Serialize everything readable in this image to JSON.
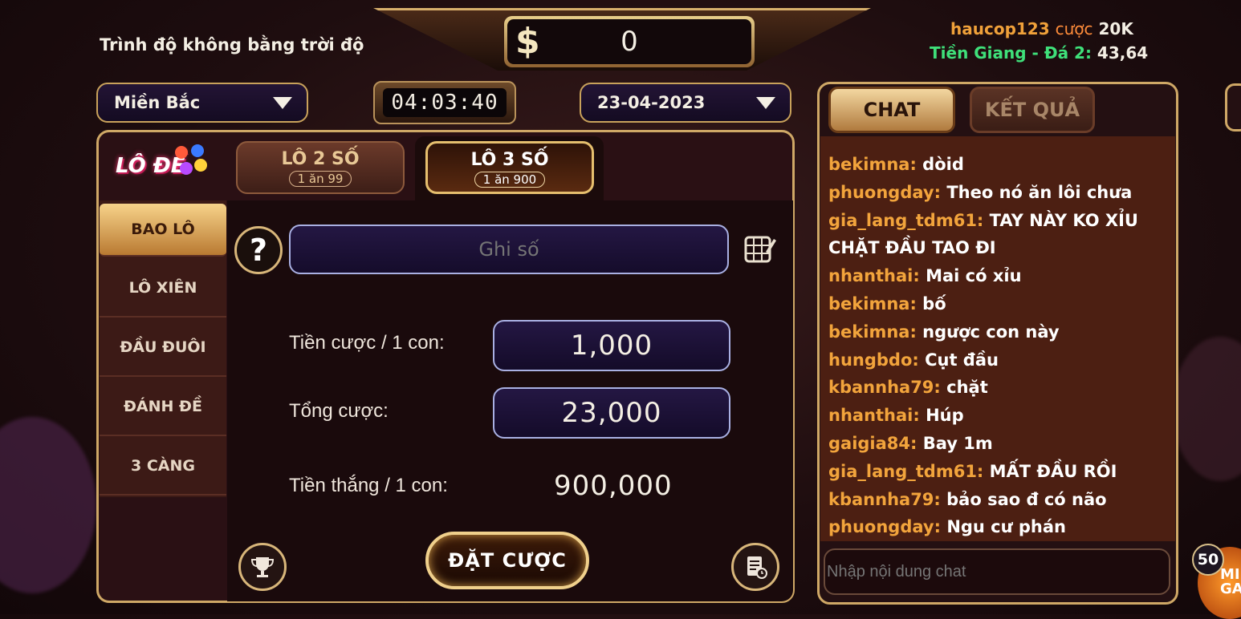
{
  "header": {
    "slogan": "Trình độ không bằng trời độ",
    "balance_icon": "$",
    "balance": "0",
    "ticker": {
      "user": "haucop123",
      "bet_word": "cược",
      "bet_amount": "20K",
      "region_text": "Tiền Giang - Đá 2:",
      "odds": "43,64"
    }
  },
  "controls": {
    "region_select": "Miền Bắc",
    "timer": "04:03:40",
    "date_select": "23-04-2023"
  },
  "game": {
    "logo_text": "LÔ ĐỀ",
    "tabs": [
      {
        "label": "LÔ 2 SỐ",
        "sub": "1 ăn 99"
      },
      {
        "label": "LÔ 3 SỐ",
        "sub": "1 ăn 900"
      }
    ],
    "nav": [
      "BAO LÔ",
      "LÔ XIÊN",
      "ĐẦU ĐUÔI",
      "ĐÁNH ĐỀ",
      "3 CÀNG"
    ],
    "help_icon": "?",
    "number_input_placeholder": "Ghi số",
    "stake_label": "Tiền cược / 1 con:",
    "stake_value": "1,000",
    "total_label": "Tổng cược:",
    "total_value": "23,000",
    "win_label": "Tiền thắng / 1 con:",
    "win_value": "900,000",
    "bet_button": "ĐẶT CƯỢC"
  },
  "chat": {
    "tabs": [
      "CHAT",
      "KẾT QUẢ"
    ],
    "messages": [
      {
        "user": "bekimna:",
        "text": "dòid"
      },
      {
        "user": "phuongday:",
        "text": "Theo nó ăn lôi chưa"
      },
      {
        "user": "gia_lang_tdm61:",
        "text": "TAY NÀY KO XỈU"
      },
      {
        "user": "",
        "text": "CHẶT ĐẦU TAO ĐI"
      },
      {
        "user": "nhanthai:",
        "text": "Mai có xỉu"
      },
      {
        "user": "bekimna:",
        "text": "bố"
      },
      {
        "user": "bekimna:",
        "text": "ngược con này"
      },
      {
        "user": "hungbdo:",
        "text": "Cụt đầu"
      },
      {
        "user": "kbannha79:",
        "text": "chặt"
      },
      {
        "user": "nhanthai:",
        "text": "Húp"
      },
      {
        "user": "gaigia84:",
        "text": "Bay 1m"
      },
      {
        "user": "gia_lang_tdm61:",
        "text": "MẤT ĐẦU RỒI"
      },
      {
        "user": "kbannha79:",
        "text": "bảo sao đ có não"
      },
      {
        "user": "phuongday:",
        "text": "Ngu cư phán"
      }
    ],
    "input_placeholder": "Nhập nội dung chat"
  },
  "mini_game": {
    "badge": "50",
    "label": "MI GA"
  },
  "colors": {
    "gold": "#cfa866",
    "username": "#f2a43c",
    "green": "#3fe07a"
  }
}
